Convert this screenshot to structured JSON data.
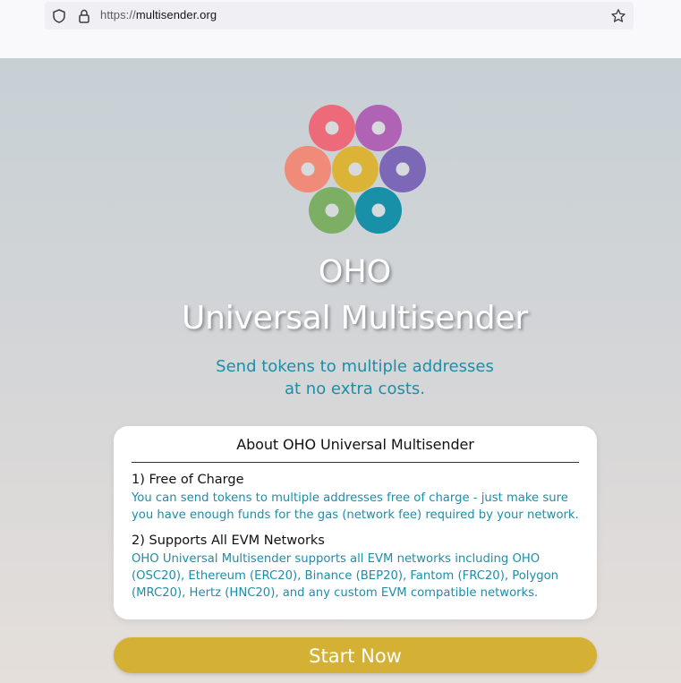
{
  "browser": {
    "url_protocol": "https://",
    "url_host": "multisender.org",
    "icons": [
      "shield-icon",
      "lock-icon",
      "star-icon"
    ]
  },
  "hero": {
    "title_line1": "OHO",
    "title_line2": "Universal Multisender",
    "tagline_line1": "Send tokens to multiple addresses",
    "tagline_line2": "at no extra costs."
  },
  "about": {
    "heading": "About OHO Universal Multisender",
    "features": [
      {
        "title": "1) Free of Charge",
        "line1": "You can send tokens to multiple addresses free of charge - just make sure",
        "line2": "you have enough funds for the gas (network fee) required by your network."
      },
      {
        "title": "2) Supports All EVM Networks",
        "line1": "OHO Universal Multisender supports all EVM networks including OHO",
        "line2": "(OSC20), Ethereum (ERC20), Binance (BEP20), Fantom (FRC20), Polygon",
        "line3": "(MRC20), Hertz (HNC20), and any custom EVM compatible networks."
      }
    ]
  },
  "cta": {
    "label": "Start Now"
  },
  "colors": {
    "accent_teal": "#1d8ea8",
    "button_gold": "#d4b035",
    "logo_dots": [
      "#ec6a7a",
      "#b062b4",
      "#ef8b78",
      "#dbb437",
      "#7d68b7",
      "#7caf63",
      "#1890a8"
    ]
  }
}
